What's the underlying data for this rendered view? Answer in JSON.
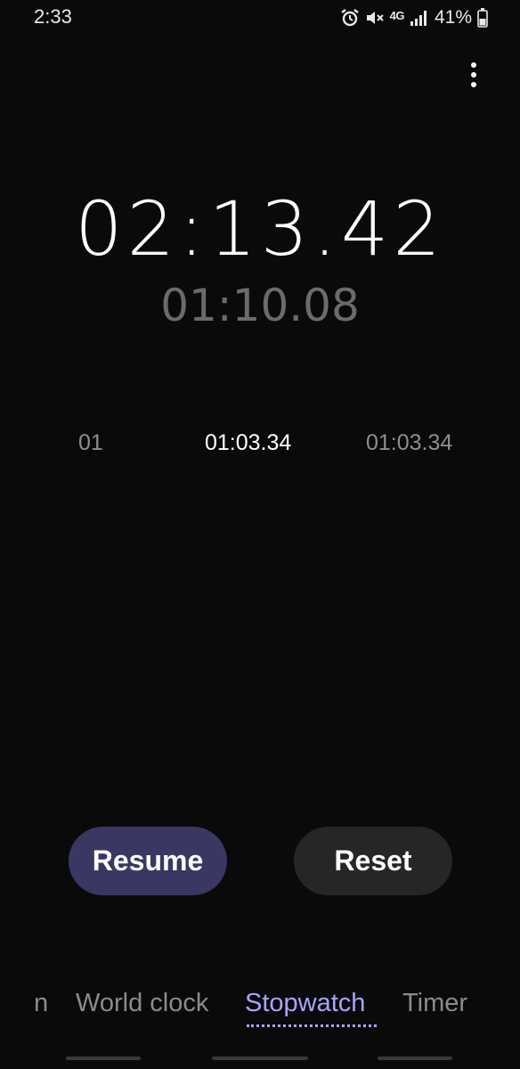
{
  "status_bar": {
    "time": "2:33",
    "network_label": "4G",
    "battery_percent": "41%",
    "icons": [
      "alarm-icon",
      "mute-icon",
      "lte-icon",
      "signal-icon",
      "battery-icon"
    ]
  },
  "menu": {
    "icon": "more-vert-icon"
  },
  "stopwatch": {
    "total_time": "02:13.42",
    "current_lap_time": "01:10.08"
  },
  "laps_header": {
    "col_lap": "01",
    "col_lap_time": "01:03.34",
    "col_overall": "01:03.34"
  },
  "buttons": {
    "resume": "Resume",
    "reset": "Reset"
  },
  "tabs": {
    "alarm_partial": "n",
    "world_clock": "World clock",
    "stopwatch": "Stopwatch",
    "timer": "Timer",
    "active": "Stopwatch"
  },
  "colors": {
    "background": "#0a0a0b",
    "accent": "#a9a3ff",
    "resume_bg": "#3a3763",
    "reset_bg": "#262626"
  }
}
